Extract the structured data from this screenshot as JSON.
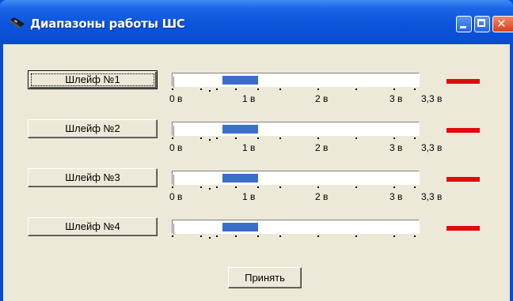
{
  "window": {
    "title": "Диапазоны работы ШС",
    "icon": "device-icon",
    "controls": [
      "minimize-icon",
      "maximize-icon",
      "close-icon"
    ]
  },
  "loops": [
    {
      "label": "Шлейф №1",
      "focused": true,
      "range_from_v": 0.6,
      "range_to_v": 1.1,
      "status_color": "#e10b0b"
    },
    {
      "label": "Шлейф №2",
      "focused": false,
      "range_from_v": 0.6,
      "range_to_v": 1.1,
      "status_color": "#e10b0b"
    },
    {
      "label": "Шлейф №3",
      "focused": false,
      "range_from_v": 0.6,
      "range_to_v": 1.1,
      "status_color": "#e10b0b"
    },
    {
      "label": "Шлейф №4",
      "focused": false,
      "range_from_v": 0.6,
      "range_to_v": 1.1,
      "status_color": "#e10b0b"
    }
  ],
  "scale": {
    "min_v": 0,
    "max_v": 3.3,
    "labels": [
      "0 в",
      "1 в",
      "2 в",
      "3 в",
      "3,3 в"
    ]
  },
  "colors": {
    "range_bar": "#3a6fc9",
    "status": "#e10b0b",
    "title_bar": "#0a55dc"
  },
  "accept_label": "Принять"
}
